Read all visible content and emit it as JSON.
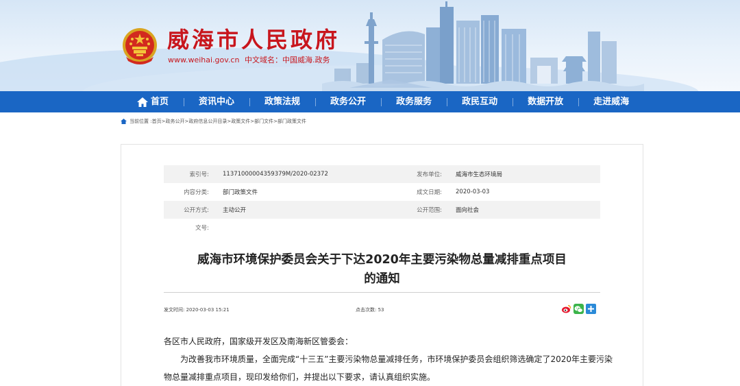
{
  "site": {
    "title": "威海市人民政府",
    "url": "www.weihai.gov.cn",
    "cn_domain": "中文域名：中国威海.政务"
  },
  "nav": {
    "items": [
      {
        "label": "首页"
      },
      {
        "label": "资讯中心"
      },
      {
        "label": "政策法规"
      },
      {
        "label": "政务公开"
      },
      {
        "label": "政务服务"
      },
      {
        "label": "政民互动"
      },
      {
        "label": "数据开放"
      },
      {
        "label": "走进威海"
      }
    ]
  },
  "breadcrumb": {
    "prefix": "当前位置 :",
    "items": [
      "首页",
      "政务公开",
      "政府信息公开目录",
      "政策文件",
      "部门文件",
      "部门政策文件"
    ],
    "sep": ">"
  },
  "meta": {
    "index_label": "索引号:",
    "index_value": "11371000004359379M/2020-02372",
    "publisher_label": "发布单位:",
    "publisher_value": "威海市生态环境局",
    "category_label": "内容分类:",
    "category_value": "部门政策文件",
    "date_label": "成文日期:",
    "date_value": "2020-03-03",
    "open_label": "公开方式:",
    "open_value": "主动公开",
    "scope_label": "公开范围:",
    "scope_value": "面向社会",
    "docno_label": "文号:",
    "docno_value": ""
  },
  "article": {
    "title_line1": "威海市环境保护委员会关于下达2020年主要污染物总量减排重点项目",
    "title_line2": "的通知",
    "pub_time_label": "发文时间:",
    "pub_time": "2020-03-03 15:21",
    "hits_label": "点击次数:",
    "hits": "53",
    "para1": "各区市人民政府，国家级开发区及南海新区管委会：",
    "para2": "为改善我市环境质量，全面完成“十三五”主要污染物总量减排任务，市环境保护委员会组织筛选确定了2020年主要污染物总量减排重点项目，现印发给你们，并提出以下要求，请认真组织实施。"
  },
  "colors": {
    "brand_red": "#c8161d",
    "nav_blue": "#1a66c4"
  }
}
